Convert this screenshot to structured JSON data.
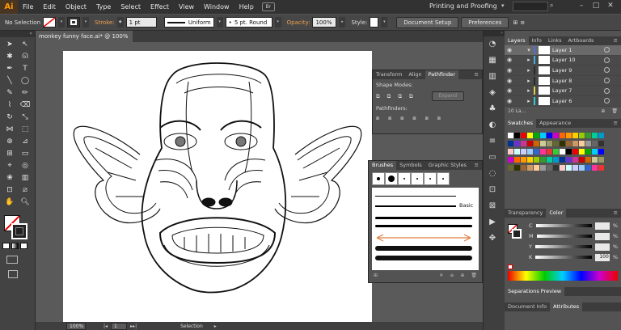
{
  "menubar": {
    "items": [
      "File",
      "Edit",
      "Object",
      "Type",
      "Select",
      "Effect",
      "View",
      "Window",
      "Help"
    ],
    "bridge_label": "Br",
    "workspace": "Printing and Proofing",
    "search_icon": "search-icon"
  },
  "control": {
    "selection_label": "No Selection",
    "stroke_label": "Stroke:",
    "stroke_value": "1 pt",
    "profile": "Uniform",
    "brush": "5 pt. Round",
    "opacity_label": "Opacity:",
    "opacity_value": "100%",
    "style_label": "Style:",
    "document_setup": "Document Setup",
    "preferences": "Preferences"
  },
  "document": {
    "tab_title": "monkey funny face.ai* @ 100% (CMYK/Preview)",
    "close": "×"
  },
  "status": {
    "zoom": "100%",
    "page": "1",
    "tool": "Selection"
  },
  "pathfinder": {
    "tabs": [
      "Transform",
      "Align",
      "Pathfinder"
    ],
    "shape_modes": "Shape Modes:",
    "pathfinders": "Pathfinders:",
    "expand": "Expand"
  },
  "brushes": {
    "tabs": [
      "Brushes",
      "Symbols",
      "Graphic Styles"
    ],
    "basic": "Basic"
  },
  "layers": {
    "tabs": [
      "Layers",
      "Info",
      "Links",
      "Artboards"
    ],
    "rows": [
      {
        "name": "Layer 1",
        "color": "#4f6fe0"
      },
      {
        "name": "Layer 10",
        "color": "#3fb0e0"
      },
      {
        "name": "Layer 9",
        "color": "#2a2a2a"
      },
      {
        "name": "Layer 8",
        "color": "#2a2a2a"
      },
      {
        "name": "Layer 7",
        "color": "#e0d040"
      },
      {
        "name": "Layer 6",
        "color": "#2ad0d0"
      }
    ],
    "count": "10 La..."
  },
  "swatches": {
    "tabs": [
      "Swatches",
      "Appearance"
    ]
  },
  "color": {
    "tabs": [
      "Transparency",
      "Color"
    ],
    "channels": [
      {
        "label": "C",
        "value": "",
        "pct": "%"
      },
      {
        "label": "M",
        "value": "",
        "pct": "%"
      },
      {
        "label": "Y",
        "value": "",
        "pct": "%"
      },
      {
        "label": "K",
        "value": "100",
        "pct": "%"
      }
    ]
  },
  "separations": {
    "tab": "Separations Preview"
  },
  "docinfo": {
    "tabs": [
      "Document Info",
      "Attributes"
    ]
  },
  "colors": {
    "accent": "#ff9a00",
    "menubar": "#323232",
    "panel": "#535353"
  }
}
